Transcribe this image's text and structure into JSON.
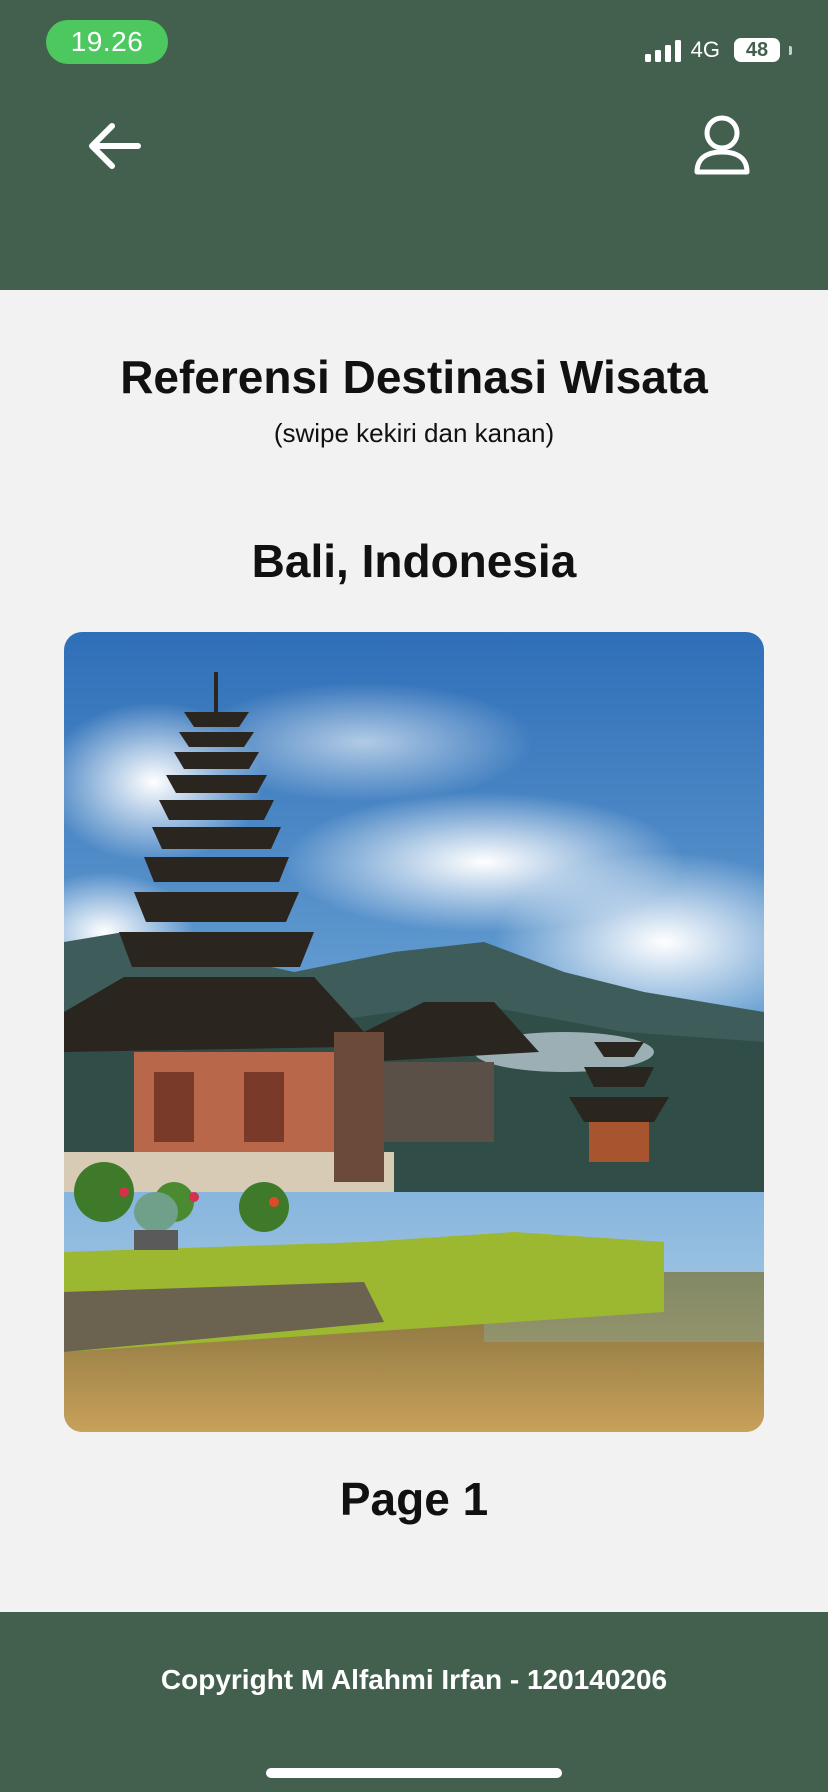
{
  "status_bar": {
    "time": "19.26",
    "network": "4G",
    "battery": "48"
  },
  "header": {
    "back_icon": "arrow-left-icon",
    "profile_icon": "user-profile-icon",
    "background_color": "#43604f"
  },
  "main": {
    "title": "Referensi Destinasi Wisata",
    "subtitle": "(swipe kekiri dan kanan)",
    "destination": "Bali, Indonesia",
    "page_label": "Page 1"
  },
  "footer": {
    "text": "Copyright M Alfahmi Irfan - 120140206"
  },
  "colors": {
    "accent": "#43604f",
    "time_pill": "#4cc85f",
    "background": "#f2f2f2"
  }
}
